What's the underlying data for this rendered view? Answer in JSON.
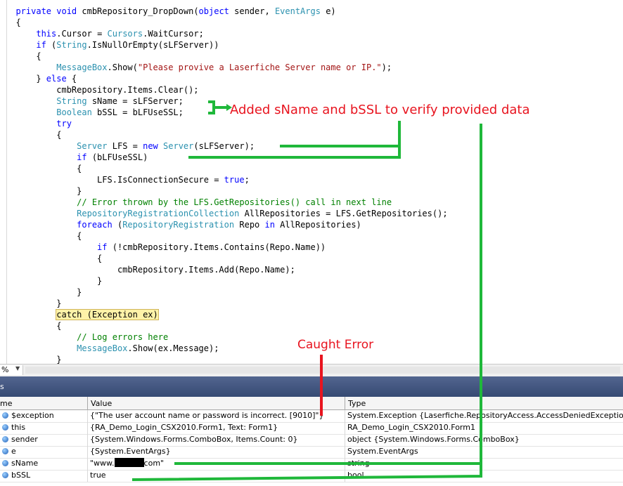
{
  "code": {
    "lines": [
      [
        [
          "  private void ",
          "kw"
        ],
        [
          "cmbRepository_DropDown(",
          ""
        ],
        [
          "object",
          "kw"
        ],
        [
          " sender, ",
          ""
        ],
        [
          "EventArgs",
          "ty"
        ],
        [
          " e)",
          ""
        ]
      ],
      [
        [
          "  {",
          ""
        ]
      ],
      [
        [
          "      ",
          ""
        ],
        [
          "this",
          "kw"
        ],
        [
          ".Cursor = ",
          ""
        ],
        [
          "Cursors",
          "ty"
        ],
        [
          ".WaitCursor;",
          ""
        ]
      ],
      [
        [
          "      ",
          ""
        ],
        [
          "if",
          "kw"
        ],
        [
          " (",
          ""
        ],
        [
          "String",
          "ty"
        ],
        [
          ".IsNullOrEmpty(sLFServer))",
          ""
        ]
      ],
      [
        [
          "      {",
          ""
        ]
      ],
      [
        [
          "          ",
          ""
        ],
        [
          "MessageBox",
          "ty"
        ],
        [
          ".Show(",
          ""
        ],
        [
          "\"Please provive a Laserfiche Server name or IP.\"",
          "st"
        ],
        [
          ");",
          ""
        ]
      ],
      [
        [
          "      } ",
          ""
        ],
        [
          "else",
          "kw"
        ],
        [
          " {",
          ""
        ]
      ],
      [
        [
          "          cmbRepository.Items.Clear();",
          ""
        ]
      ],
      [
        [
          "          ",
          ""
        ],
        [
          "String",
          "ty"
        ],
        [
          " sName = sLFServer;",
          ""
        ]
      ],
      [
        [
          "          ",
          ""
        ],
        [
          "Boolean",
          "ty"
        ],
        [
          " bSSL = bLFUseSSL;",
          ""
        ]
      ],
      [
        [
          "          ",
          ""
        ],
        [
          "try",
          "kw"
        ]
      ],
      [
        [
          "          {",
          ""
        ]
      ],
      [
        [
          "              ",
          ""
        ],
        [
          "Server",
          "ty"
        ],
        [
          " LFS = ",
          ""
        ],
        [
          "new",
          "kw"
        ],
        [
          " ",
          ""
        ],
        [
          "Server",
          "ty"
        ],
        [
          "(sLFServer);",
          ""
        ]
      ],
      [
        [
          "              ",
          ""
        ],
        [
          "if",
          "kw"
        ],
        [
          " (bLFUseSSL)",
          ""
        ]
      ],
      [
        [
          "              {",
          ""
        ]
      ],
      [
        [
          "                  LFS.IsConnectionSecure = ",
          ""
        ],
        [
          "true",
          "kw"
        ],
        [
          ";",
          ""
        ]
      ],
      [
        [
          "              }",
          ""
        ]
      ],
      [
        [
          "              ",
          ""
        ],
        [
          "// Error thrown by the LFS.GetRepositories() call in next line",
          "cm"
        ]
      ],
      [
        [
          "              ",
          ""
        ],
        [
          "RepositoryRegistrationCollection",
          "ty"
        ],
        [
          " AllRepositories = LFS.GetRepositories();",
          ""
        ]
      ],
      [
        [
          "              ",
          ""
        ],
        [
          "foreach",
          "kw"
        ],
        [
          " (",
          ""
        ],
        [
          "RepositoryRegistration",
          "ty"
        ],
        [
          " Repo ",
          ""
        ],
        [
          "in",
          "kw"
        ],
        [
          " AllRepositories)",
          ""
        ]
      ],
      [
        [
          "              {",
          ""
        ]
      ],
      [
        [
          "                  ",
          ""
        ],
        [
          "if",
          "kw"
        ],
        [
          " (!cmbRepository.Items.Contains(Repo.Name))",
          ""
        ]
      ],
      [
        [
          "                  {",
          ""
        ]
      ],
      [
        [
          "                      cmbRepository.Items.Add(Repo.Name);",
          ""
        ]
      ],
      [
        [
          "                  }",
          ""
        ]
      ],
      [
        [
          "              }",
          ""
        ]
      ],
      [
        [
          "          }",
          ""
        ]
      ],
      [
        [
          "          ",
          ""
        ],
        [
          "catch (Exception ex)",
          "hl"
        ]
      ],
      [
        [
          "          {",
          ""
        ]
      ],
      [
        [
          "              ",
          ""
        ],
        [
          "// Log errors here",
          "cm"
        ]
      ],
      [
        [
          "              ",
          ""
        ],
        [
          "MessageBox",
          "ty"
        ],
        [
          ".Show(ex.Message);",
          ""
        ]
      ],
      [
        [
          "          }",
          ""
        ]
      ]
    ]
  },
  "annotations": {
    "added_note": "Added sName and bSSL to verify provided data",
    "caught_error": "Caught Error"
  },
  "status_bar": {
    "zoom": "%"
  },
  "locals_window": {
    "title": "s",
    "columns": {
      "name": "me",
      "value": "Value",
      "type": "Type"
    },
    "rows": [
      {
        "name": "$exception",
        "value": "{\"The user account name or password is incorrect. [9010]\"}",
        "type": "System.Exception {Laserfiche.RepositoryAccess.AccessDeniedException}"
      },
      {
        "name": "this",
        "value": "{RA_Demo_Login_CSX2010.Form1, Text: Form1}",
        "type": "RA_Demo_Login_CSX2010.Form1"
      },
      {
        "name": "sender",
        "value": "{System.Windows.Forms.ComboBox, Items.Count: 0}",
        "type": "object {System.Windows.Forms.ComboBox}"
      },
      {
        "name": "e",
        "value": "{System.EventArgs}",
        "type": "System.EventArgs"
      },
      {
        "name": "sName",
        "value_prefix": "\"www.",
        "value_suffix": "com\"",
        "type": "string"
      },
      {
        "name": "bSSL",
        "value": "true",
        "type": "bool"
      }
    ]
  },
  "colors": {
    "annotation": "#e8141f",
    "arrow": "#1fb83a"
  }
}
